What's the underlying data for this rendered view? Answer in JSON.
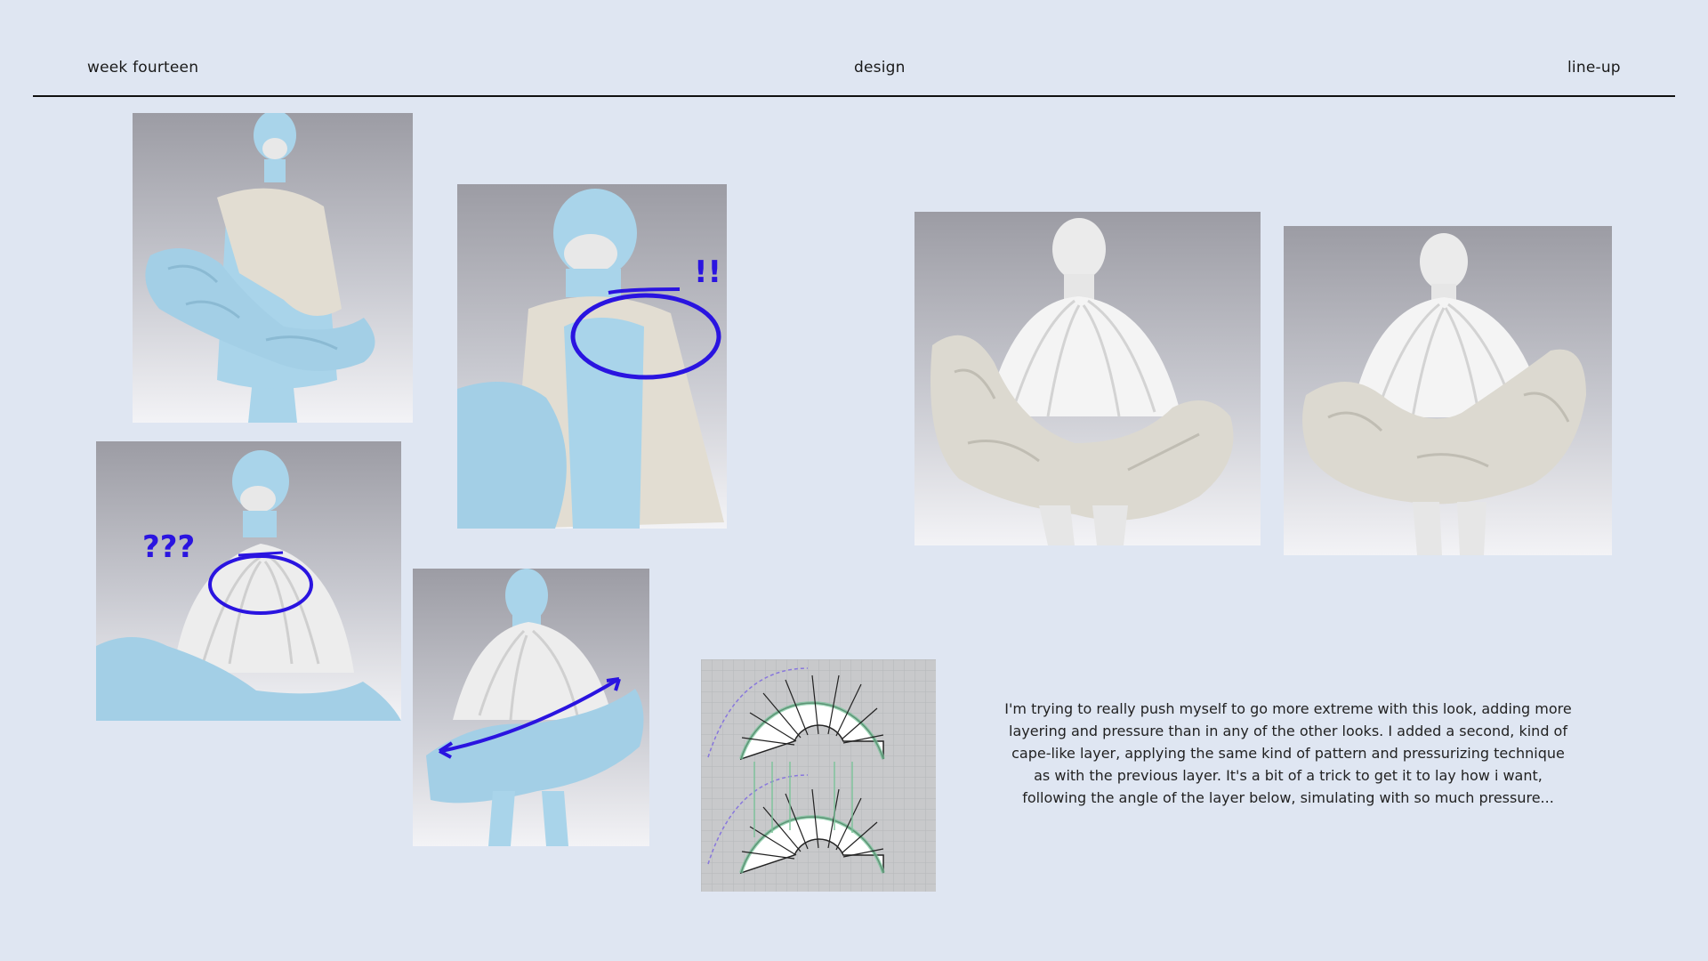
{
  "header": {
    "left": "week fourteen",
    "center": "design",
    "right": "line-up"
  },
  "annotations": {
    "exclaim": "!!",
    "question": "???"
  },
  "caption": "I'm trying to really push myself to go more extreme with this look, adding more layering and pressure than in any of the other looks. I added a second, kind of cape-like layer, applying the same kind of pattern and pressurizing technique as with the previous layer. It's a bit of a trick to get it to lay how i want, following the angle of the layer below, simulating with so much pressure...",
  "colors": {
    "background": "#dfe6f2",
    "annotation": "#2a14e0",
    "fabric_blue": "#a9d4ea",
    "fabric_beige": "#e2ddd2",
    "fabric_white": "#ededed",
    "avatar": "#e8e8e8"
  }
}
